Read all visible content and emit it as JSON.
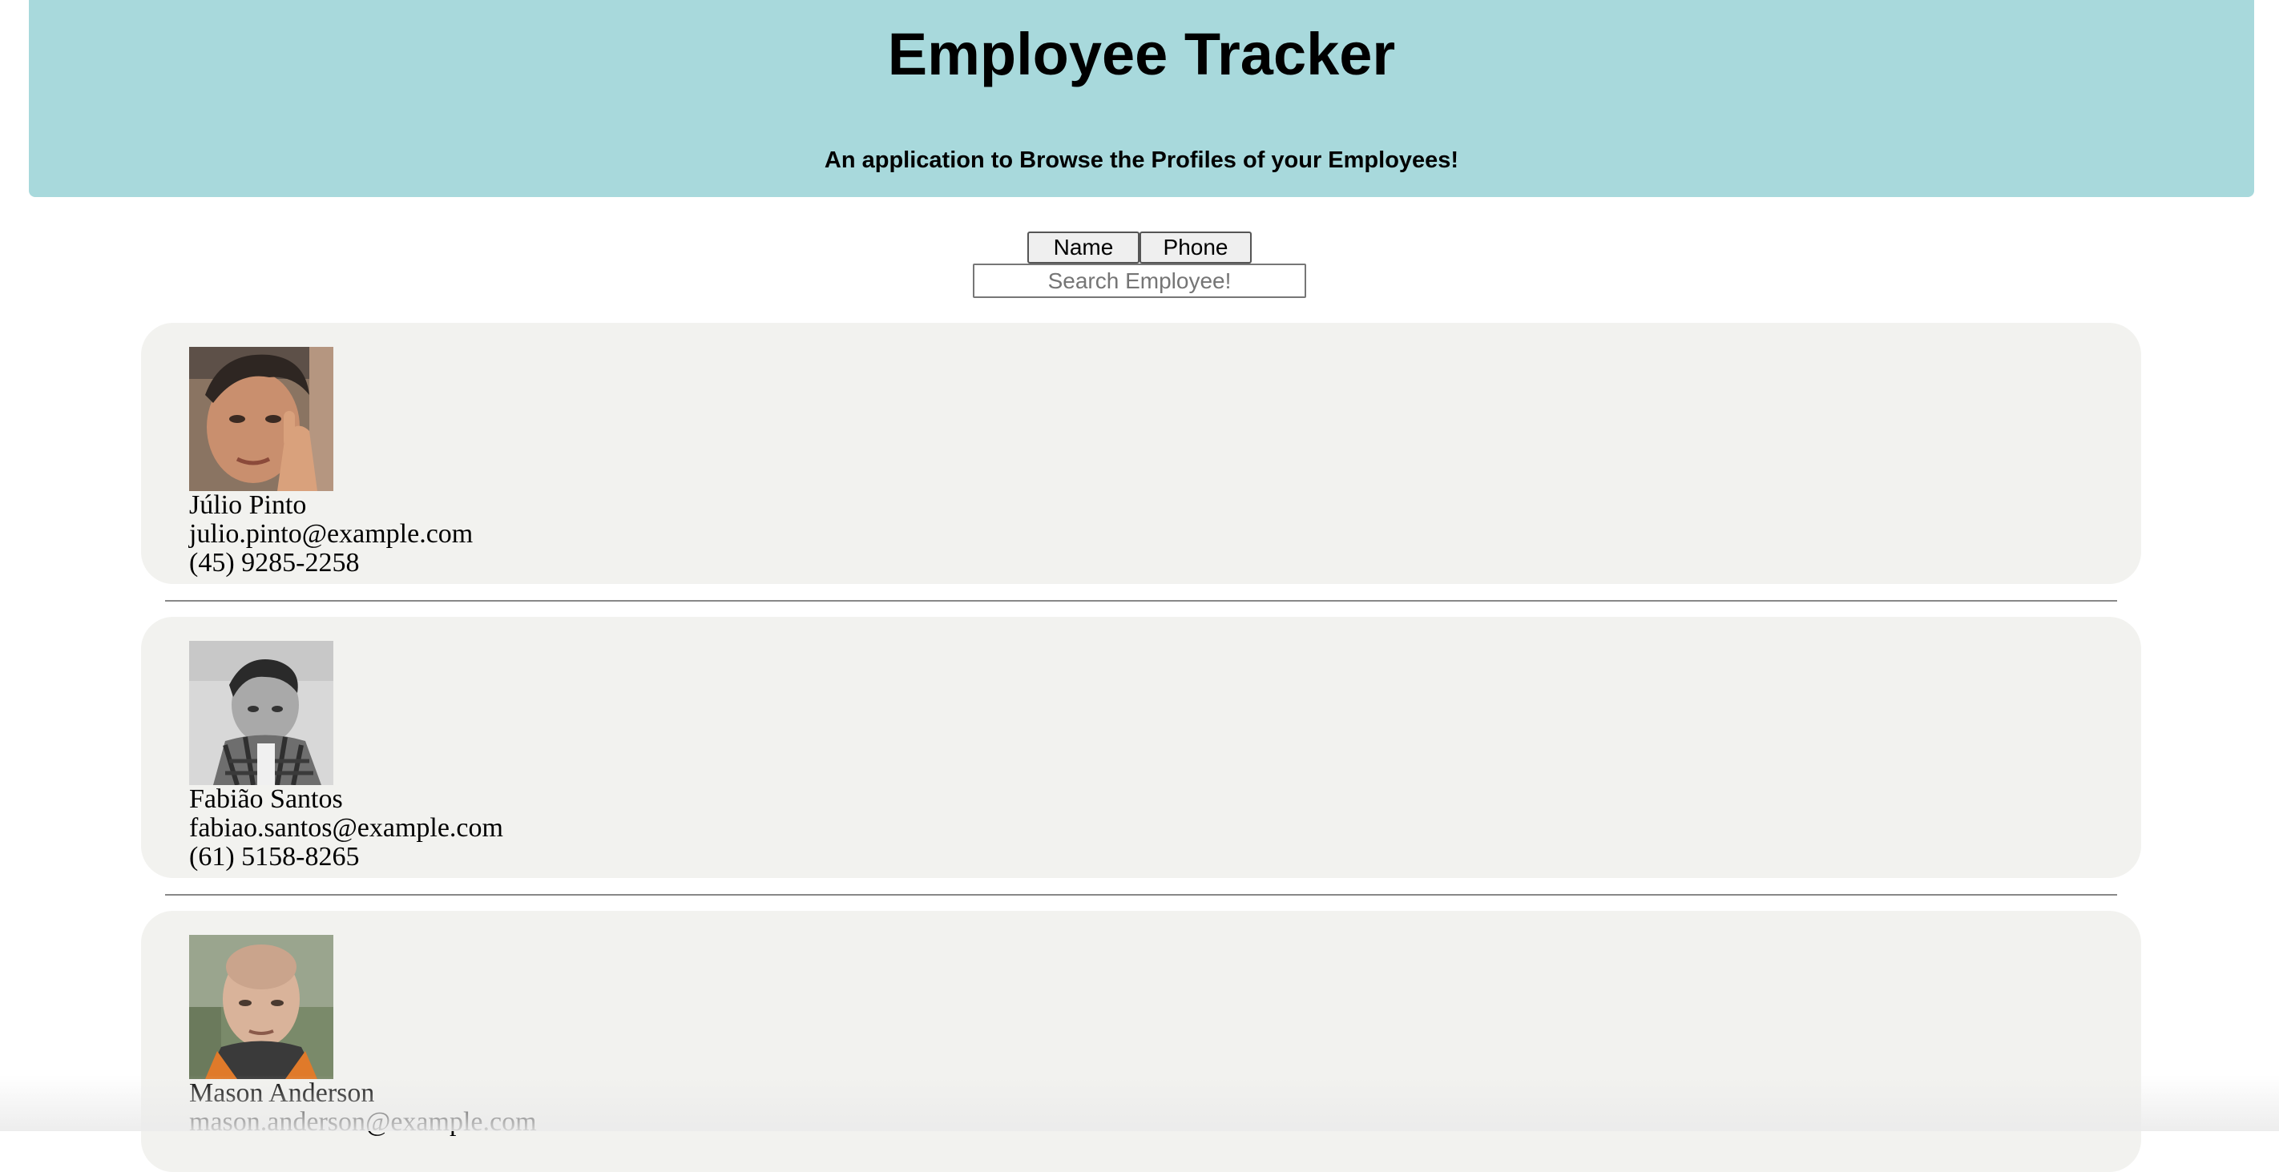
{
  "header": {
    "title": "Employee Tracker",
    "subtitle": "An application to Browse the Profiles of your Employees!",
    "background_color": "#a8d9dc"
  },
  "sort": {
    "name_label": "Name",
    "phone_label": "Phone"
  },
  "search": {
    "placeholder": "Search Employee!",
    "value": ""
  },
  "employees": [
    {
      "name": "Júlio Pinto",
      "email": "julio.pinto@example.com",
      "phone": "(45) 9285-2258"
    },
    {
      "name": "Fabião Santos",
      "email": "fabiao.santos@example.com",
      "phone": "(61) 5158-8265"
    },
    {
      "name": "Mason Anderson",
      "email": "mason.anderson@example.com",
      "phone": ""
    }
  ],
  "colors": {
    "card_background": "#f2f2ef",
    "divider": "#888888"
  }
}
